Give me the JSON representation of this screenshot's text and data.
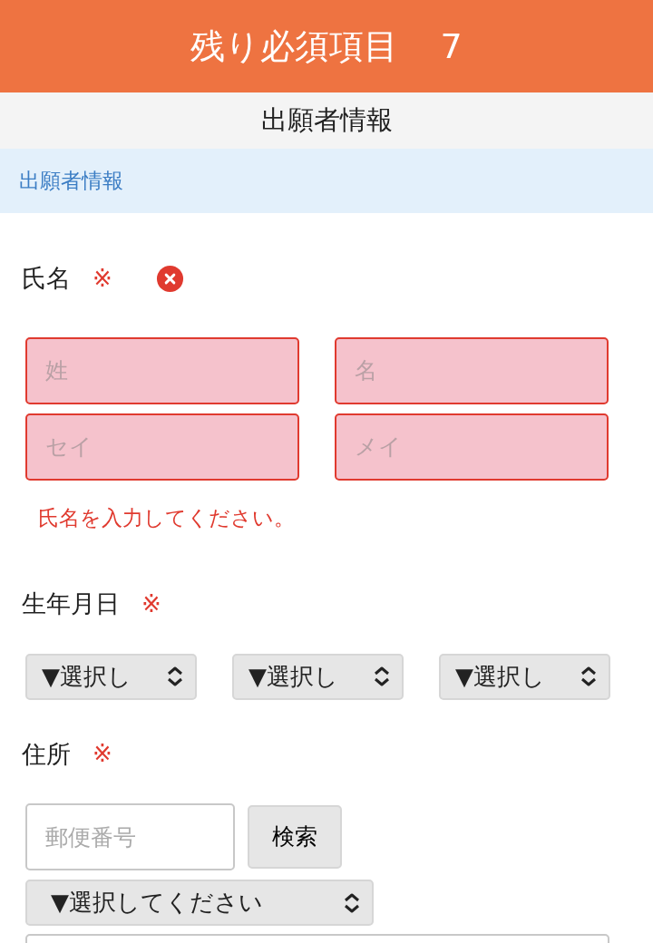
{
  "header": {
    "label": "残り必須項目",
    "count": "7"
  },
  "page_title": "出願者情報",
  "section": {
    "title": "出願者情報"
  },
  "fields": [
    {
      "kind": "name",
      "label": "氏名",
      "required_mark": "※",
      "invalid": true,
      "inputs": [
        {
          "placeholder": "姓"
        },
        {
          "placeholder": "名"
        },
        {
          "placeholder": "セイ"
        },
        {
          "placeholder": "メイ"
        }
      ],
      "error": "氏名を入力してください。"
    },
    {
      "kind": "date",
      "label": "生年月日",
      "required_mark": "※",
      "invalid": false,
      "selects": [
        {
          "value": "▼選択し"
        },
        {
          "value": "▼選択し"
        },
        {
          "value": "▼選択し"
        }
      ]
    },
    {
      "kind": "address",
      "label": "住所",
      "required_mark": "※",
      "invalid": false,
      "postal": {
        "placeholder": "郵便番号"
      },
      "search_button": "検索",
      "select": {
        "value": "▼選択してください"
      }
    }
  ]
}
